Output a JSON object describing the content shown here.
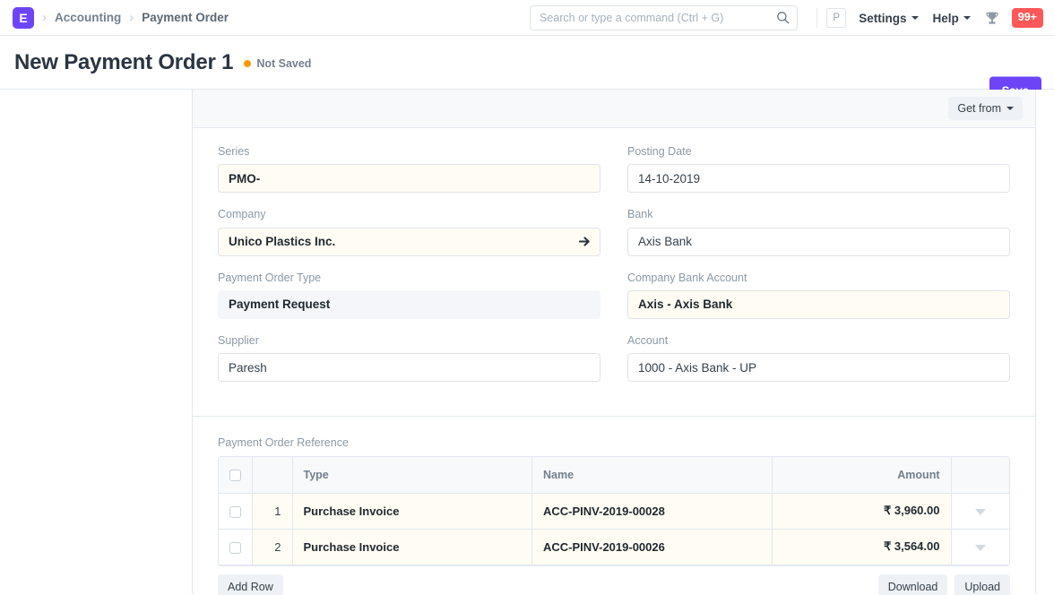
{
  "navbar": {
    "logo_letter": "E",
    "breadcrumbs": [
      {
        "label": "Accounting"
      },
      {
        "label": "Payment Order"
      }
    ],
    "search": {
      "placeholder": "Search or type a command (Ctrl + G)",
      "value": ""
    },
    "avatar_letter": "P",
    "settings_label": "Settings",
    "help_label": "Help",
    "notification_count": "99+",
    "notification_color": "#ff5858",
    "brand_color": "#6e45f6"
  },
  "titlebar": {
    "title": "New Payment Order 1",
    "status_label": "Not Saved",
    "status_color": "#ff9800",
    "save_label": "Save"
  },
  "toolbar": {
    "get_from_label": "Get from"
  },
  "form": {
    "fields": [
      {
        "label": "Series",
        "value": "PMO-",
        "style": "mandatory"
      },
      {
        "label": "Posting Date",
        "value": "14-10-2019",
        "style": "normal"
      },
      {
        "label": "Company",
        "value": "Unico Plastics Inc.",
        "style": "mandatory",
        "icon": "arrow-right-icon"
      },
      {
        "label": "Bank",
        "value": "Axis Bank",
        "style": "normal"
      },
      {
        "label": "Payment Order Type",
        "value": "Payment Request",
        "style": "readonly"
      },
      {
        "label": "Company Bank Account",
        "value": "Axis - Axis Bank",
        "style": "mandatory"
      },
      {
        "label": "Supplier",
        "value": "Paresh",
        "style": "normal"
      },
      {
        "label": "Account",
        "value": "1000 - Axis Bank - UP",
        "style": "normal"
      }
    ]
  },
  "grid": {
    "label": "Payment Order Reference",
    "columns": [
      "",
      "",
      "Type",
      "Name",
      "Amount",
      ""
    ],
    "rows": [
      {
        "index": "1",
        "type": "Purchase Invoice",
        "name": "ACC-PINV-2019-00028",
        "amount": "₹ 3,960.00"
      },
      {
        "index": "2",
        "type": "Purchase Invoice",
        "name": "ACC-PINV-2019-00026",
        "amount": "₹ 3,564.00"
      }
    ],
    "add_row_label": "Add Row",
    "download_label": "Download",
    "upload_label": "Upload"
  }
}
